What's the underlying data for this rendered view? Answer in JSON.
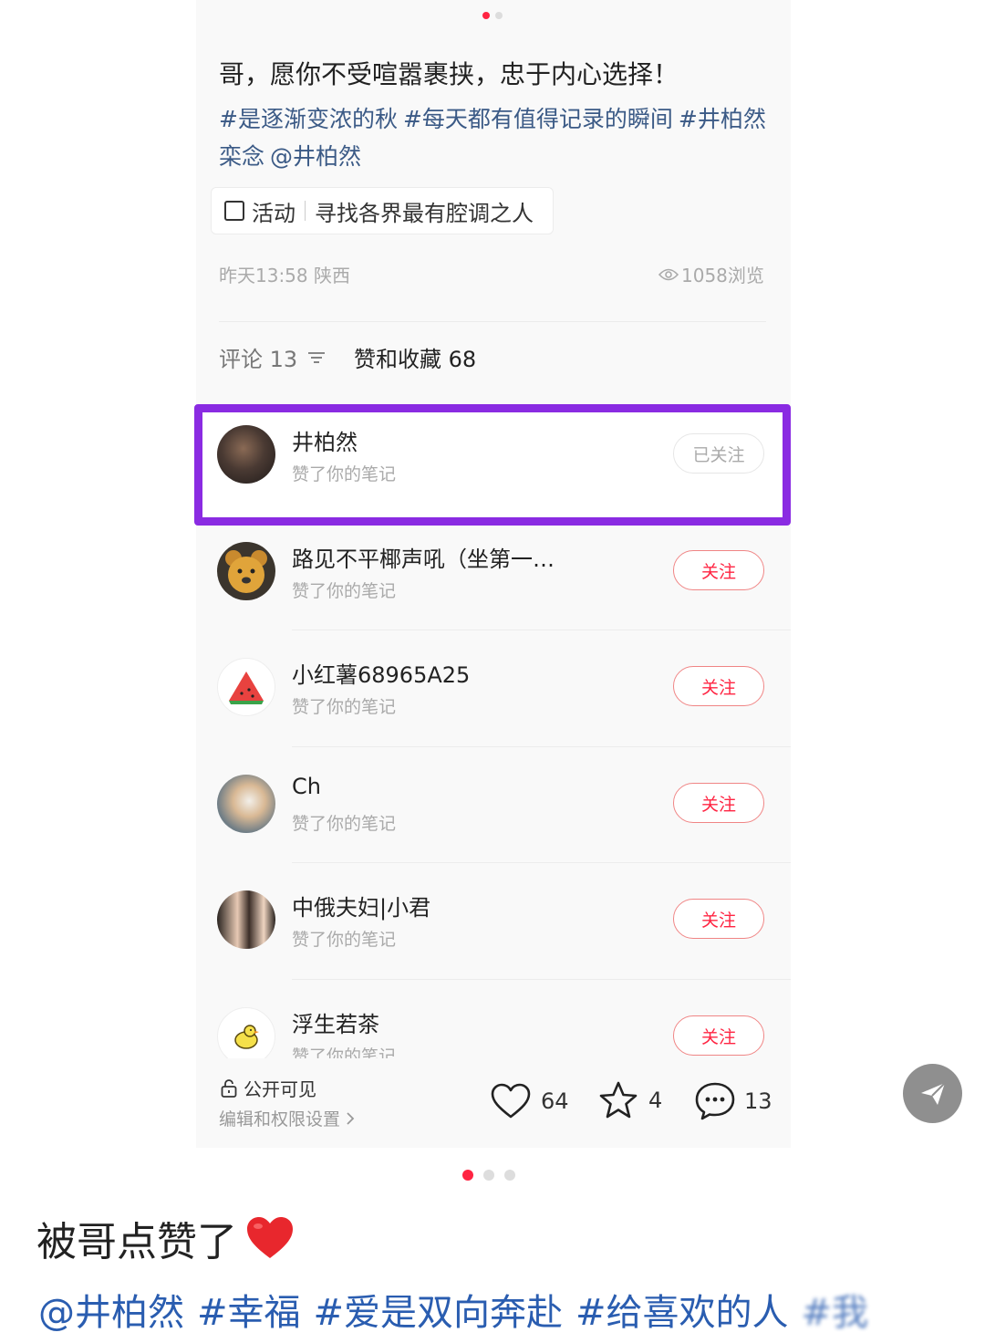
{
  "post": {
    "title": "哥，愿你不受喧嚣裹挟，忠于内心选择！",
    "tags": [
      "#是逐渐变浓的秋",
      "#每天都有值得记录的瞬间",
      "#井柏然栾念",
      "@井柏然"
    ],
    "activity_label": "活动",
    "activity_text": "寻找各界最有腔调之人",
    "time_location": "昨天13:58 陕西",
    "views": "1058浏览"
  },
  "tabs": {
    "comments": "评论 13",
    "likes": "赞和收藏 68"
  },
  "likers": [
    {
      "name": "井柏然",
      "subtitle": "赞了你的笔记",
      "button": "已关注",
      "avatar": "person-photo-icon"
    },
    {
      "name": "路见不平椰声吼（坐第一…",
      "subtitle": "赞了你的笔记",
      "button": "关注",
      "avatar": "bear-icon"
    },
    {
      "name": "小红薯68965A25",
      "subtitle": "赞了你的笔记",
      "button": "关注",
      "avatar": "watermelon-icon"
    },
    {
      "name": "Ch",
      "subtitle": "赞了你的笔记",
      "button": "关注",
      "avatar": "cat-photo-icon"
    },
    {
      "name": "中俄夫妇|小君",
      "subtitle": "赞了你的笔记",
      "button": "关注",
      "avatar": "couple-photo-icon"
    },
    {
      "name": "浮生若茶",
      "subtitle": "赞了你的笔记",
      "button": "关注",
      "avatar": "duck-icon"
    }
  ],
  "bottom": {
    "visibility": "公开可见",
    "settings": "编辑和权限设置",
    "like_count": "64",
    "collect_count": "4",
    "comment_count": "13"
  },
  "caption": {
    "text": "被哥点赞了",
    "tags": [
      "@井柏然",
      "#幸福",
      "#爱是双向奔赴",
      "#给喜欢的人",
      "#我"
    ]
  },
  "colors": {
    "accent": "#ff2442",
    "highlight": "#8a2be2",
    "tag": "#3b5a86"
  }
}
